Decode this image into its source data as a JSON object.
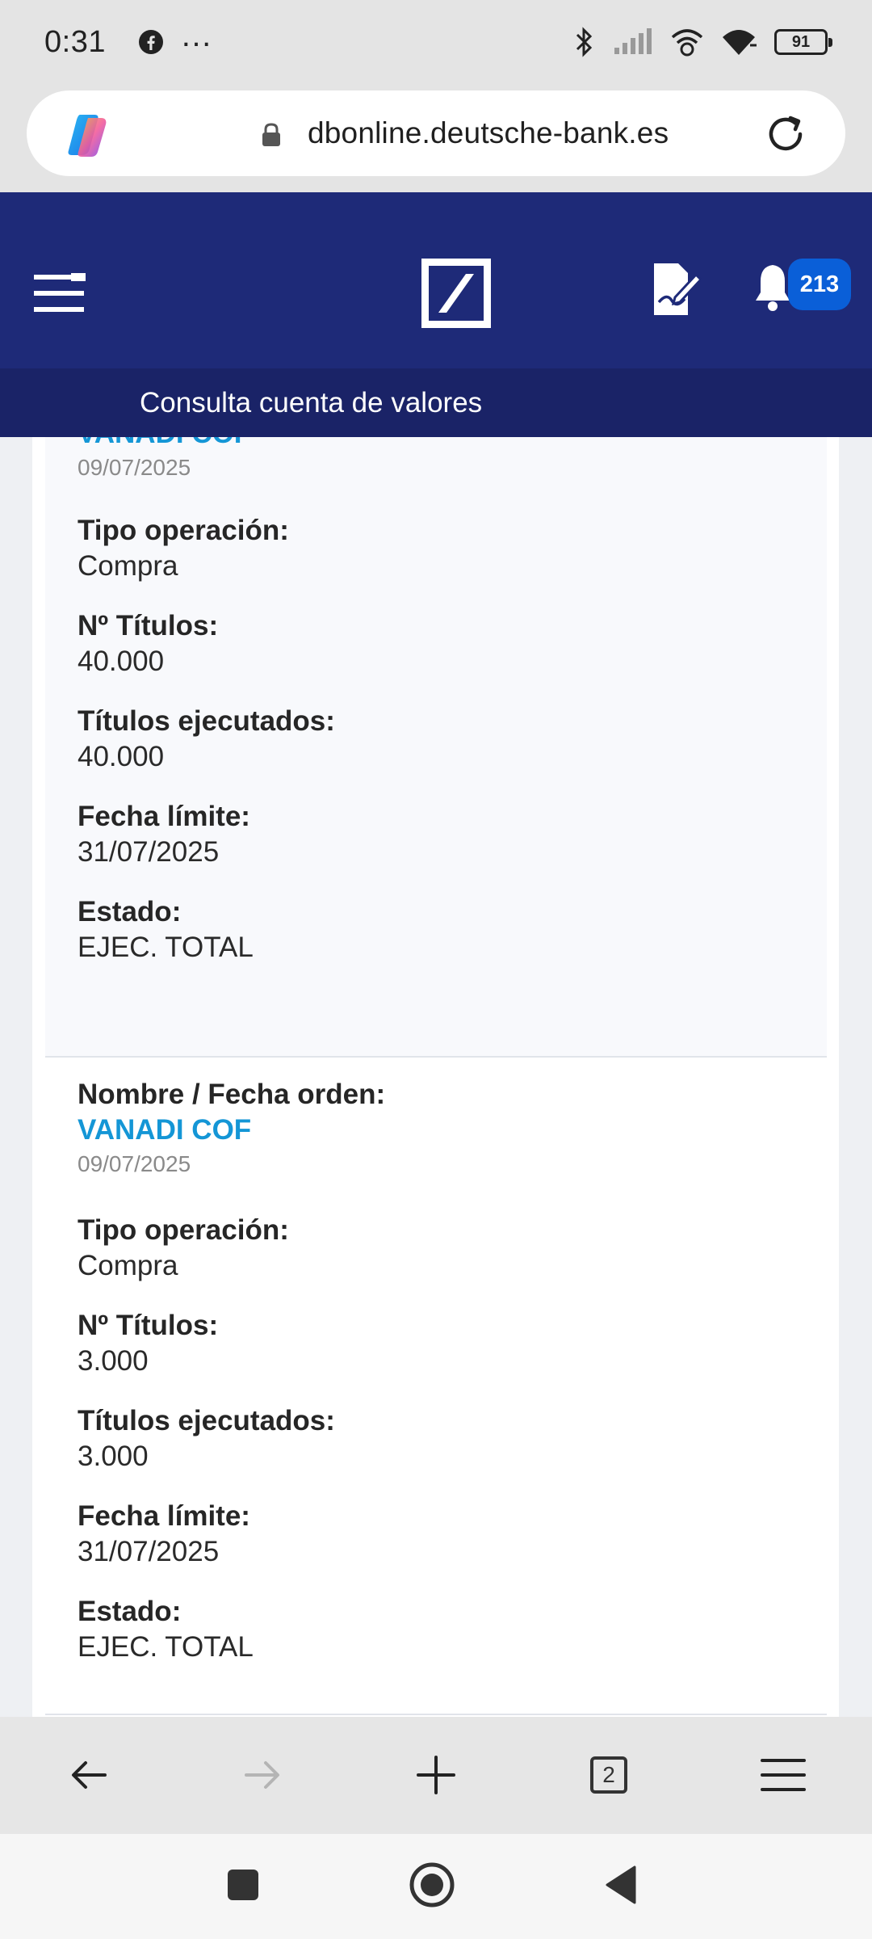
{
  "status_bar": {
    "time": "0:31",
    "left_icons": [
      "facebook-icon",
      "more-dots-icon"
    ],
    "right_icons": [
      "bluetooth-icon",
      "signal-icon",
      "wifi-calling-icon",
      "wifi-icon"
    ],
    "battery": "91"
  },
  "browser": {
    "url": "dbonline.deutsche-bank.es",
    "tab_count": "2"
  },
  "header": {
    "notification_count": "213",
    "subtitle": "Consulta cuenta de valores",
    "bar_color": "#1e2a78"
  },
  "orders": [
    {
      "name_partial": "VANADI COF",
      "date": "09/07/2025",
      "tipo_label": "Tipo operación:",
      "tipo_value": "Compra",
      "titulos_label": "Nº Títulos:",
      "titulos_value": "40.000",
      "ejecutados_label": "Títulos ejecutados:",
      "ejecutados_value": "40.000",
      "fecha_label": "Fecha límite:",
      "fecha_value": "31/07/2025",
      "estado_label": "Estado:",
      "estado_value": "EJEC. TOTAL"
    },
    {
      "nombre_label": "Nombre / Fecha orden:",
      "name": "VANADI COF",
      "date": "09/07/2025",
      "tipo_label": "Tipo operación:",
      "tipo_value": "Compra",
      "titulos_label": "Nº Títulos:",
      "titulos_value": "3.000",
      "ejecutados_label": "Títulos ejecutados:",
      "ejecutados_value": "3.000",
      "fecha_label": "Fecha límite:",
      "fecha_value": "31/07/2025",
      "estado_label": "Estado:",
      "estado_value": "EJEC. TOTAL"
    }
  ],
  "colors": {
    "link": "#1496d6",
    "badge": "#0a5fd8"
  }
}
